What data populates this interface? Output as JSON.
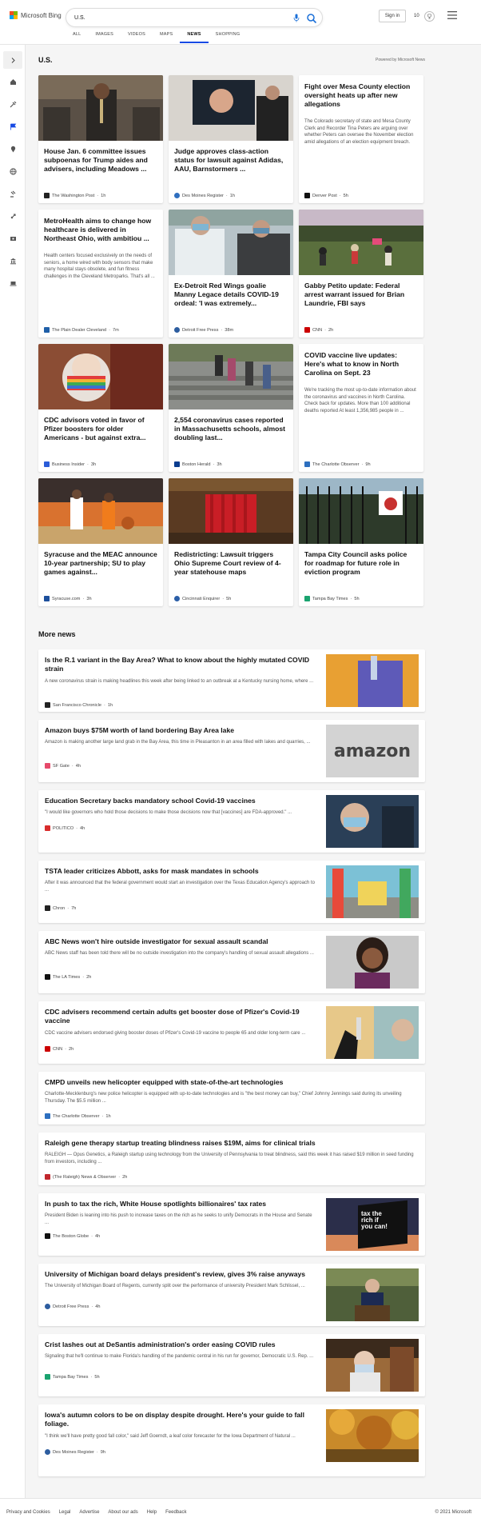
{
  "header": {
    "brand": "Microsoft Bing",
    "search_value": "U.S.",
    "signin_label": "Sign in",
    "rewards_count": "10",
    "nav": [
      "ALL",
      "IMAGES",
      "VIDEOS",
      "MAPS",
      "NEWS",
      "SHOPPING"
    ],
    "active_nav": "NEWS"
  },
  "page": {
    "title": "U.S.",
    "powered": "Powered by Microsoft News",
    "more_title": "More news"
  },
  "cards": [
    {
      "title": "House Jan. 6 committee issues subpoenas for Trump aides and advisers, including Meadows ...",
      "source": "The Washington Post",
      "time": "1h",
      "snippet": ""
    },
    {
      "title": "Judge approves class-action status for lawsuit against Adidas, AAU, Barnstormers ...",
      "source": "Des Moines Register",
      "time": "1h",
      "snippet": ""
    },
    {
      "title": "Fight over Mesa County election oversight heats up after new allegations",
      "source": "Denver Post",
      "time": "5h",
      "snippet": "The Colorado secretary of state and Mesa County Clerk and Recorder Tina Peters are arguing over whether Peters can oversee the November election amid allegations of an election equipment breach."
    },
    {
      "title": "MetroHealth aims to change how healthcare is delivered in Northeast Ohio, with ambitiou ...",
      "source": "The Plain Dealer Cleveland",
      "time": "7m",
      "snippet": "Health centers focused exclusively on the needs of seniors, a home wired with body sensors that make many hospital stays obsolete, and fun fitness challenges in the Cleveland Metroparks. That's all ..."
    },
    {
      "title": "Ex-Detroit Red Wings goalie Manny Legace details COVID-19 ordeal: 'I was extremely...",
      "source": "Detroit Free Press",
      "time": "38m",
      "snippet": ""
    },
    {
      "title": "Gabby Petito update: Federal arrest warrant issued for Brian Laundrie, FBI says",
      "source": "CNN",
      "time": "2h",
      "snippet": ""
    },
    {
      "title": "CDC advisors voted in favor of Pfizer boosters for older Americans - but against extra...",
      "source": "Business Insider",
      "time": "3h",
      "snippet": ""
    },
    {
      "title": "2,554 coronavirus cases reported in Massachusetts schools, almost doubling last...",
      "source": "Boston Herald",
      "time": "3h",
      "snippet": ""
    },
    {
      "title": "COVID vaccine live updates: Here's what to know in North Carolina on Sept. 23",
      "source": "The Charlotte Observer",
      "time": "9h",
      "snippet": "We're tracking the most up-to-date information about the coronavirus and vaccines in North Carolina. Check back for updates. More than 100 additional deaths reported At least 1,356,985 people in ..."
    },
    {
      "title": "Syracuse and the MEAC announce 10-year partnership; SU to play games against...",
      "source": "Syracuse.com",
      "time": "3h",
      "snippet": ""
    },
    {
      "title": "Redistricting: Lawsuit triggers Ohio Supreme Court review of 4-year statehouse maps",
      "source": "Cincinnati Enquirer",
      "time": "5h",
      "snippet": ""
    },
    {
      "title": "Tampa City Council asks police for roadmap for future role in eviction program",
      "source": "Tampa Bay Times",
      "time": "5h",
      "snippet": ""
    }
  ],
  "more_news": [
    {
      "title": "Is the R.1 variant in the Bay Area? What to know about the highly mutated COVID strain",
      "snippet": "A new coronavirus strain is making headlines this week after being linked to an outbreak at a Kentucky nursing home, where ...",
      "source": "San Francisco Chronicle",
      "time": "1h"
    },
    {
      "title": "Amazon buys $75M worth of land bordering Bay Area lake",
      "snippet": "Amazon is making another large land grab in the Bay Area, this time in Pleasanton in an area filled with lakes and quarries, ...",
      "source": "SF Gate",
      "time": "4h",
      "image_text": "amazon"
    },
    {
      "title": "Education Secretary backs mandatory school Covid-19 vaccines",
      "snippet": "\"I would like governors who hold those decisions to make those decisions now that [vaccines] are FDA-approved.\" ...",
      "source": "POLITICO",
      "time": "4h"
    },
    {
      "title": "TSTA leader criticizes Abbott, asks for mask mandates in schools",
      "snippet": "After it was announced that the federal government would start an investigation over the Texas Education Agency's approach to ...",
      "source": "Chron",
      "time": "7h"
    },
    {
      "title": "ABC News won't hire outside investigator for sexual assault scandal",
      "snippet": "ABC News staff has been told there will be no outside investigation into the company's handling of sexual assault allegations ...",
      "source": "The LA Times",
      "time": "2h"
    },
    {
      "title": "CDC advisers recommend certain adults get booster dose of Pfizer's Covid-19 vaccine",
      "snippet": "CDC vaccine advisers endorsed giving booster doses of Pfizer's Covid-19 vaccine to people 65 and older long-term care ...",
      "source": "CNN",
      "time": "2h"
    },
    {
      "title": "CMPD unveils new helicopter equipped with state-of-the-art technologies",
      "snippet": "Charlotte-Mecklenburg's new police helicopter is equipped with up-to-date technologies and is \"the best money can buy,\" Chief Johnny Jennings said during its unveiling Thursday. The $5.5 million ...",
      "source": "The Charlotte Observer",
      "time": "1h"
    },
    {
      "title": "Raleigh gene therapy startup treating blindness raises $19M, aims for clinical trials",
      "snippet": "RALEIGH — Opus Genetics, a Raleigh startup using technology from the University of Pennsylvania to treat blindness, said this week it has raised $19 million in seed funding from investors, including ...",
      "source": "(The Raleigh) News & Observer",
      "time": "2h"
    },
    {
      "title": "In push to tax the rich, White House spotlights billionaires' tax rates",
      "snippet": "President Biden is leaning into his push to increase taxes on the rich as he seeks to unify Democrats in the House and Senate ...",
      "source": "The Boston Globe",
      "time": "4h",
      "image_text": "tax the rich if you can!"
    },
    {
      "title": "University of Michigan board delays president's review, gives 3% raise anyways",
      "snippet": "The University of Michigan Board of Regents, currently split over the performance of university President Mark Schlissel, ...",
      "source": "Detroit Free Press",
      "time": "4h"
    },
    {
      "title": "Crist lashes out at DeSantis administration's order easing COVID rules",
      "snippet": "Signaling that he'll continue to make Florida's handling of the pandemic central in his run for governor, Democratic U.S. Rep. ...",
      "source": "Tampa Bay Times",
      "time": "5h"
    },
    {
      "title": "Iowa's autumn colors to be on display despite drought. Here's your guide to fall foliage.",
      "snippet": "\"I think we'll have pretty good fall color,\" said Jeff Goerndt, a leaf color forecaster for the Iowa Department of Natural ...",
      "source": "Des Moines Register",
      "time": "9h"
    }
  ],
  "footer": {
    "links": [
      "Privacy and Cookies",
      "Legal",
      "Advertise",
      "About our ads",
      "Help",
      "Feedback"
    ],
    "copyright": "© 2021 Microsoft"
  }
}
